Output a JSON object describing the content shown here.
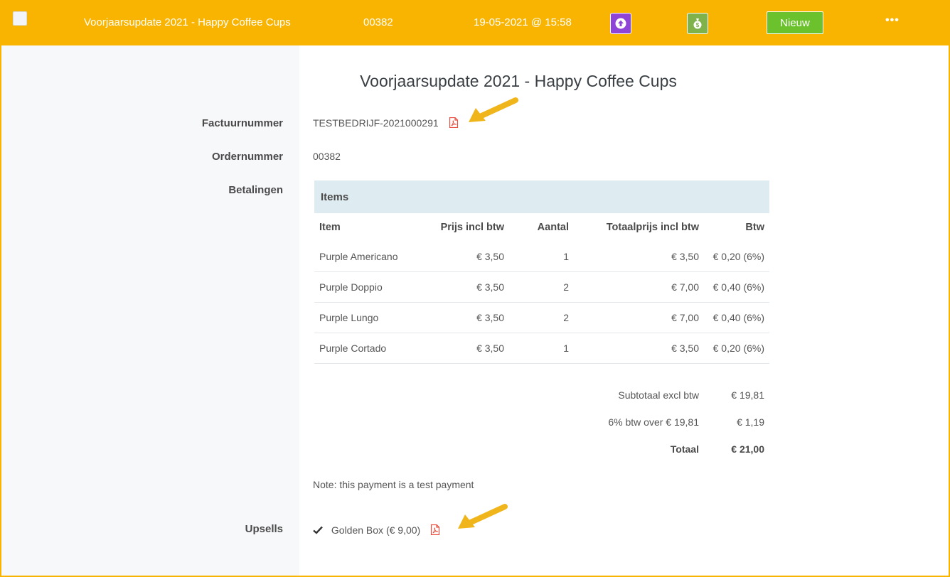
{
  "topbar": {
    "title": "Voorjaarsupdate 2021 - Happy Coffee Cups",
    "order": "00382",
    "datetime": "19-05-2021 @ 15:58",
    "upload_icon": "arrow-up-circle-icon",
    "money_icon": "money-bag-icon",
    "status_button": "Nieuw",
    "more_icon": "more-dots-icon"
  },
  "page": {
    "title": "Voorjaarsupdate 2021 - Happy Coffee Cups"
  },
  "fields": {
    "invoice_label": "Factuurnummer",
    "invoice_value": "TESTBEDRIJF-2021000291",
    "order_label": "Ordernummer",
    "order_value": "00382",
    "payments_label": "Betalingen",
    "upsells_label": "Upsells"
  },
  "items": {
    "header": "Items",
    "columns": [
      "Item",
      "Prijs incl btw",
      "Aantal",
      "Totaalprijs incl btw",
      "Btw"
    ],
    "rows": [
      {
        "item": "Purple Americano",
        "price": "€ 3,50",
        "qty": "1",
        "total": "€ 3,50",
        "btw": "€ 0,20 (6%)"
      },
      {
        "item": "Purple Doppio",
        "price": "€ 3,50",
        "qty": "2",
        "total": "€ 7,00",
        "btw": "€ 0,40 (6%)"
      },
      {
        "item": "Purple Lungo",
        "price": "€ 3,50",
        "qty": "2",
        "total": "€ 7,00",
        "btw": "€ 0,40 (6%)"
      },
      {
        "item": "Purple Cortado",
        "price": "€ 3,50",
        "qty": "1",
        "total": "€ 3,50",
        "btw": "€ 0,20 (6%)"
      }
    ]
  },
  "summary": {
    "subtotal_label": "Subtotaal excl btw",
    "subtotal_value": "€ 19,81",
    "vat_label": "6% btw over € 19,81",
    "vat_value": "€ 1,19",
    "total_label": "Totaal",
    "total_value": "€ 21,00"
  },
  "note": "Note: this payment is a test payment",
  "upsell": {
    "text": "Golden Box (€ 9,00)",
    "check_icon": "checkmark-icon"
  },
  "colors": {
    "topbar": "#f8b400",
    "purple_button": "#8e44d6",
    "green_icon_button": "#7fb24a",
    "new_button": "#6bc22d",
    "pdf_icon": "#e74c3c",
    "items_header_bg": "#deebf1",
    "annotation_arrow": "#f0b51a"
  }
}
